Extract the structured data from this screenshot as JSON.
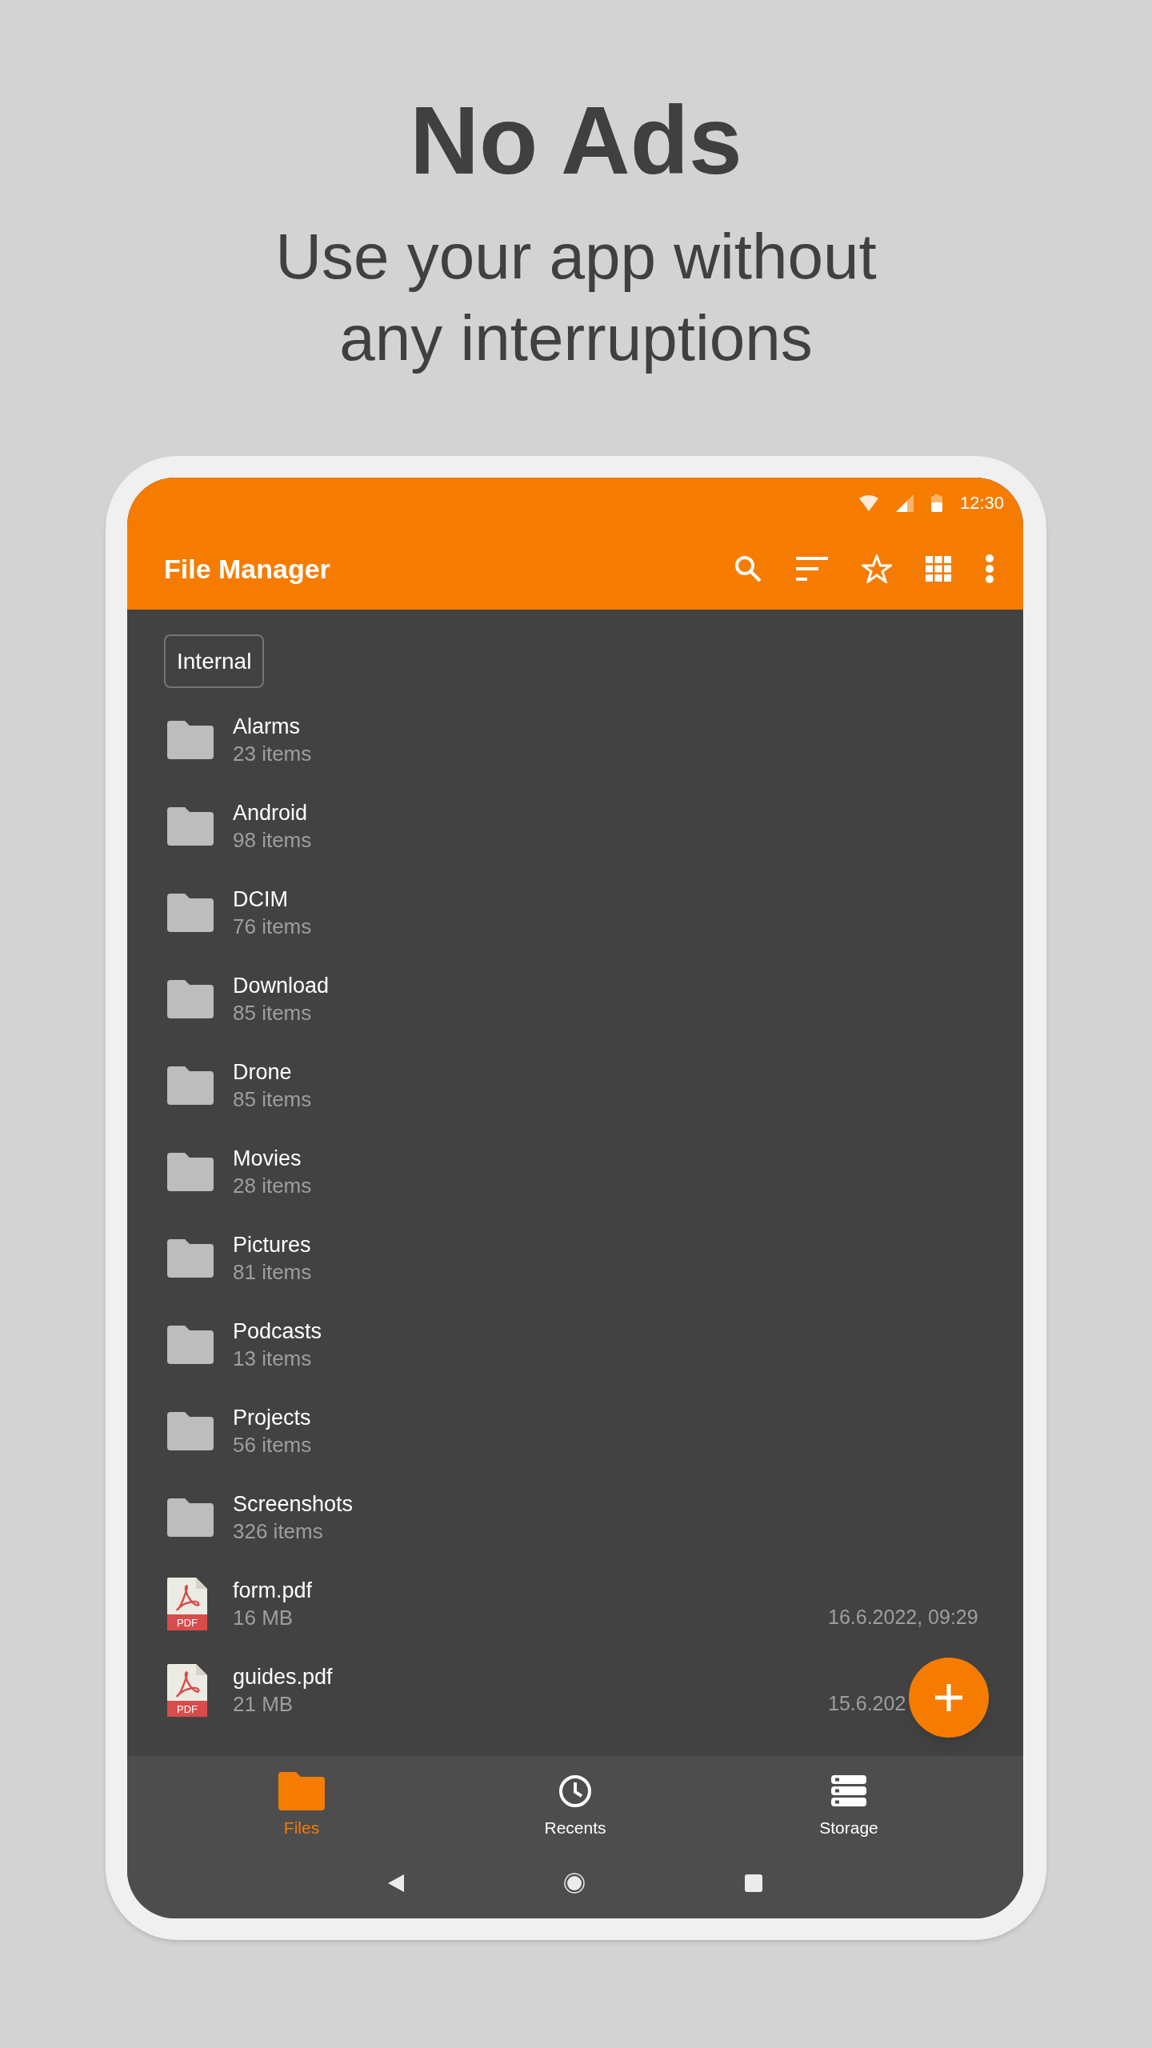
{
  "headline": "No Ads",
  "subtitle": [
    "Use your app without",
    "any interruptions"
  ],
  "status_bar": {
    "time": "12:30"
  },
  "toolbar": {
    "title": "File Manager"
  },
  "location_chip": "Internal",
  "items": [
    {
      "kind": "folder",
      "name": "Alarms",
      "detail": "23 items"
    },
    {
      "kind": "folder",
      "name": "Android",
      "detail": "98 items"
    },
    {
      "kind": "folder",
      "name": "DCIM",
      "detail": "76 items"
    },
    {
      "kind": "folder",
      "name": "Download",
      "detail": "85 items"
    },
    {
      "kind": "folder",
      "name": "Drone",
      "detail": "85 items"
    },
    {
      "kind": "folder",
      "name": "Movies",
      "detail": "28 items"
    },
    {
      "kind": "folder",
      "name": "Pictures",
      "detail": "81 items"
    },
    {
      "kind": "folder",
      "name": "Podcasts",
      "detail": "13 items"
    },
    {
      "kind": "folder",
      "name": "Projects",
      "detail": "56 items"
    },
    {
      "kind": "folder",
      "name": "Screenshots",
      "detail": "326 items"
    },
    {
      "kind": "file",
      "name": "form.pdf",
      "detail": "16 MB",
      "date": "16.6.2022, 09:29",
      "badge": "PDF"
    },
    {
      "kind": "file",
      "name": "guides.pdf",
      "detail": "21 MB",
      "date": "15.6.202",
      "badge": "PDF"
    }
  ],
  "bottom_nav": [
    {
      "kind": "files",
      "label": "Files",
      "selected": true
    },
    {
      "kind": "recents",
      "label": "Recents",
      "selected": false
    },
    {
      "kind": "storage",
      "label": "Storage",
      "selected": false
    }
  ]
}
